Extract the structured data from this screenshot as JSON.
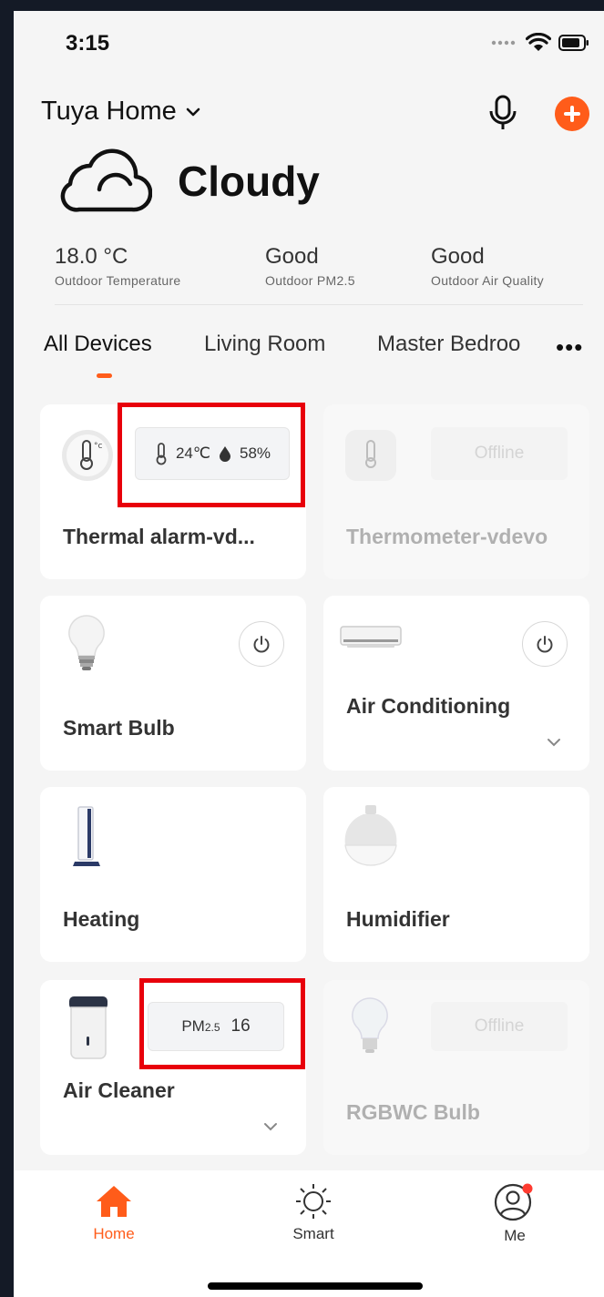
{
  "status_bar": {
    "time": "3:15",
    "signal_icon": "signal-dots-icon",
    "wifi_icon": "wifi-icon",
    "battery_icon": "battery-icon"
  },
  "header": {
    "home_name": "Tuya Home",
    "chevron_icon": "chevron-down-icon",
    "mic_icon": "microphone-icon",
    "add_icon": "plus-icon"
  },
  "weather": {
    "condition": "Cloudy",
    "icon": "cloud-icon",
    "stats": [
      {
        "value": "18.0 °C",
        "label": "Outdoor Temperature"
      },
      {
        "value": "Good",
        "label": "Outdoor PM2.5"
      },
      {
        "value": "Good",
        "label": "Outdoor Air Quality"
      }
    ]
  },
  "tabs": [
    {
      "label": "All Devices",
      "active": true
    },
    {
      "label": "Living Room",
      "active": false
    },
    {
      "label": "Master Bedroo",
      "active": false
    }
  ],
  "tabs_more": "•••",
  "devices": [
    {
      "name": "Thermal alarm-vd...",
      "icon": "thermometer-sensor-icon",
      "status": {
        "temp": "24℃",
        "humidity": "58%"
      },
      "online": true
    },
    {
      "name": "Thermometer-vdevo",
      "icon": "thermometer-sensor-icon",
      "offline_label": "Offline",
      "online": false
    },
    {
      "name": "Smart Bulb",
      "icon": "bulb-icon",
      "power_icon": "power-icon",
      "online": true
    },
    {
      "name": "Air Conditioning",
      "icon": "air-conditioner-icon",
      "power_icon": "power-icon",
      "online": true
    },
    {
      "name": "Heating",
      "icon": "heater-icon",
      "online": true
    },
    {
      "name": "Humidifier",
      "icon": "humidifier-icon",
      "online": true
    },
    {
      "name": "Air Cleaner",
      "icon": "air-purifier-icon",
      "status": {
        "pm_label": "PM",
        "pm_sub": "2.5",
        "pm_value": "16"
      },
      "online": true
    },
    {
      "name": "RGBWC Bulb",
      "icon": "bulb-icon",
      "offline_label": "Offline",
      "online": false
    }
  ],
  "bottom_nav": [
    {
      "label": "Home",
      "icon": "home-icon",
      "active": true
    },
    {
      "label": "Smart",
      "icon": "sun-icon",
      "active": false
    },
    {
      "label": "Me",
      "icon": "user-icon",
      "active": false,
      "badge": true
    }
  ],
  "colors": {
    "accent": "#ff5c1a",
    "highlight": "#e8000b",
    "background": "#f5f5f5"
  }
}
